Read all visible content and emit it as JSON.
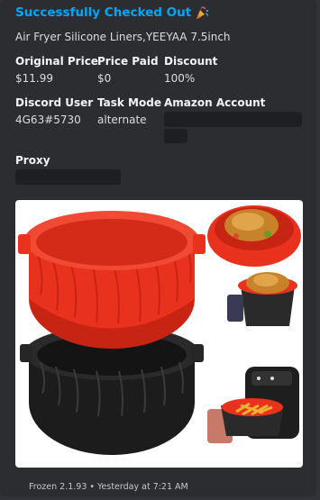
{
  "embed": {
    "title": "Successfully Checked Out",
    "title_icon": "party-popper-icon",
    "description": "Air Fryer Silicone Liners,YEEYAA 7.5inch",
    "fields": {
      "original_price": {
        "name": "Original Price",
        "value": "$11.99"
      },
      "price_paid": {
        "name": "Price Paid",
        "value": "$0"
      },
      "discount": {
        "name": "Discount",
        "value": "100%"
      },
      "discord_user": {
        "name": "Discord User",
        "value": "4G63#5730"
      },
      "task_mode": {
        "name": "Task Mode",
        "value": "alternate"
      },
      "amazon_account": {
        "name": "Amazon Account"
      },
      "proxy": {
        "name": "Proxy"
      }
    },
    "footer": {
      "app": "Frozen 2.1.93",
      "separator": "•",
      "timestamp": "Yesterday at 7:21 AM"
    }
  },
  "colors": {
    "title": "#00a8fc",
    "embed_bg": "#2b2d31",
    "page_bg": "#313338",
    "redaction": "#1e1f22",
    "liner_red": "#e8321e",
    "liner_black": "#262626"
  }
}
